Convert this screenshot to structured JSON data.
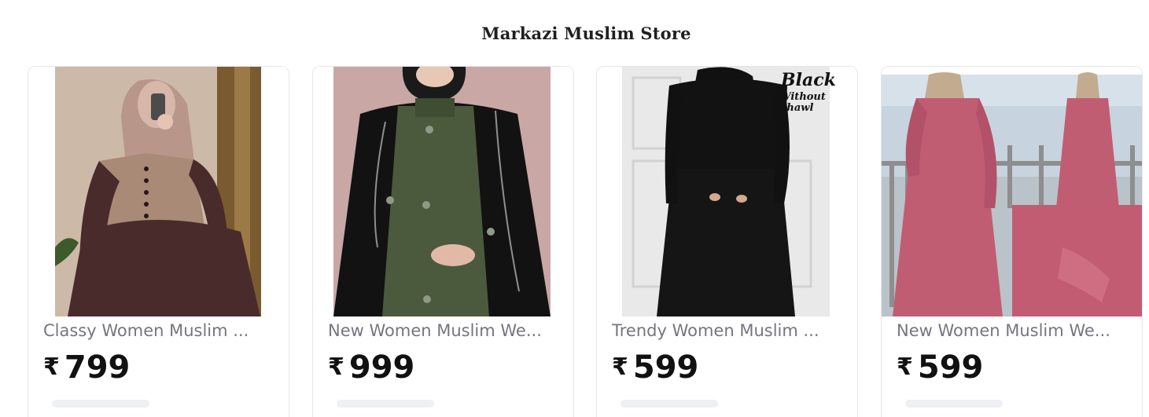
{
  "store": {
    "title": "Markazi Muslim Store"
  },
  "products": [
    {
      "name": "Classy Women Muslim ...",
      "currency": "₹",
      "price": "799",
      "image_alt": "woman in mauve abaya with hijab taking mirror selfie"
    },
    {
      "name": "New Women Muslim We...",
      "currency": "₹",
      "price": "999",
      "image_alt": "olive green abaya with black open cape"
    },
    {
      "name": "Trendy Women Muslim ...",
      "currency": "₹",
      "price": "599",
      "image_alt": "black abaya on model",
      "image_overlay_text": [
        "Black",
        "Without",
        "Shawl"
      ]
    },
    {
      "name": "New Women Muslim We...",
      "currency": "₹",
      "price": "599",
      "image_alt": "rose pink abaya with beige hijab, front and back views"
    }
  ],
  "colors": {
    "title": "#1f1f1f",
    "product_name": "#77747f",
    "price": "#111111",
    "card_border": "#e6e6ea"
  }
}
